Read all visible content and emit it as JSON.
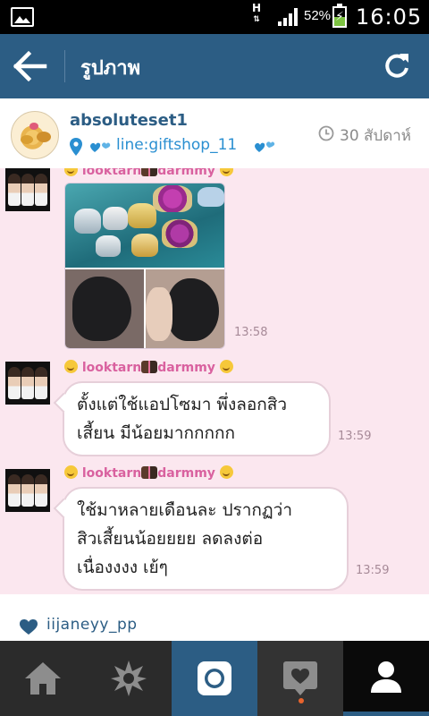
{
  "status_bar": {
    "battery_percent": "52%",
    "battery_level": 0.52,
    "network": "H",
    "time": "16:05",
    "icons": [
      "gallery-notification-icon",
      "data-arrows-icon",
      "signal-icon",
      "battery-charging-icon"
    ]
  },
  "header": {
    "title": "รูปภาพ",
    "back_icon": "arrow-left-icon",
    "refresh_icon": "refresh-icon"
  },
  "post": {
    "username": "absoluteset1",
    "location": "line:giftshop_11",
    "timestamp": "30 สัปดาห์",
    "colors": {
      "brand": "#2c5d84",
      "link": "#2a8fd1",
      "photo_bg": "#fbe7ef"
    }
  },
  "chat": {
    "messages": [
      {
        "sender": "looktarn",
        "sender_suffix": "darmmy",
        "kind": "image",
        "time": "13:58"
      },
      {
        "sender": "looktarn",
        "sender_suffix": "darmmy",
        "kind": "text",
        "lines": [
          "ตั้งแต่ใช้แอปโซมา พึ่งลอกสิว",
          "เสี้ยน มีน้อยมากกกกก"
        ],
        "time": "13:59"
      },
      {
        "sender": "looktarn",
        "sender_suffix": "darmmy",
        "kind": "text",
        "lines": [
          "ใช้มาหลายเดือนละ ปรากฏว่า",
          "สิวเสี้ยนน้อยยยย ลดลงต่อ",
          "เนื่องงงง เย้ๆ"
        ],
        "time": "13:59"
      }
    ]
  },
  "likes": {
    "user": "iijaneyy_pp",
    "icon": "heart-icon"
  },
  "bottom_nav": {
    "items": [
      {
        "name": "home",
        "icon": "home-icon"
      },
      {
        "name": "explore",
        "icon": "explore-star-icon"
      },
      {
        "name": "camera",
        "icon": "camera-icon"
      },
      {
        "name": "news",
        "icon": "activity-heart-icon"
      },
      {
        "name": "profile",
        "icon": "profile-icon",
        "selected": true
      }
    ]
  }
}
